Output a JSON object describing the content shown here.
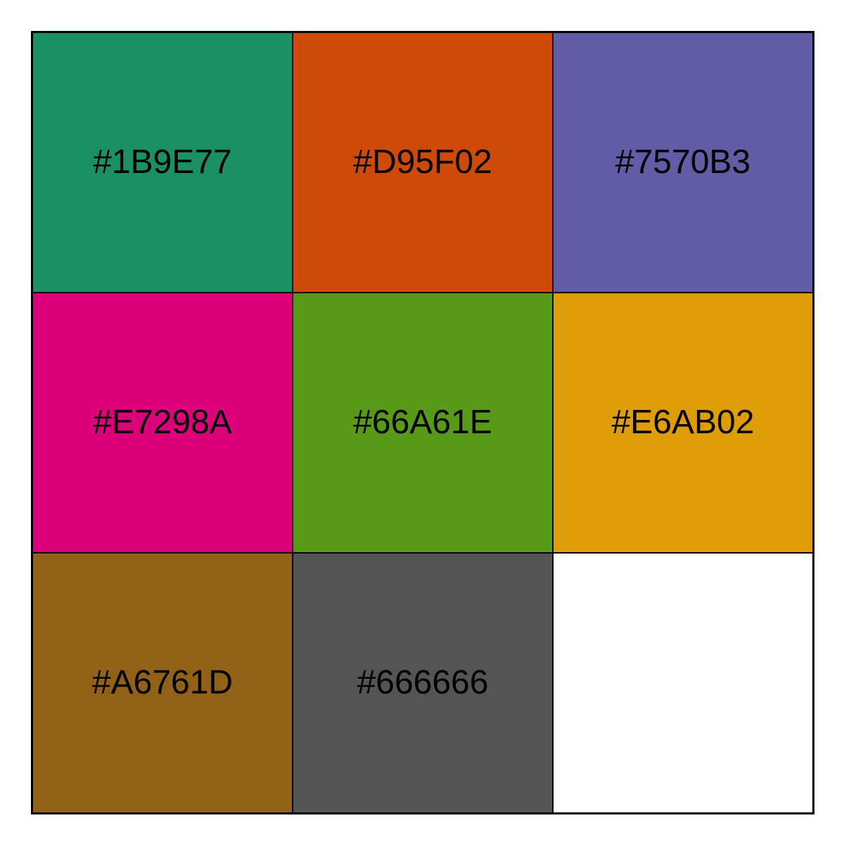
{
  "swatches": [
    {
      "label": "#1B9E77",
      "fill": "#1b8f65"
    },
    {
      "label": "#D95F02",
      "fill": "#cd4a09"
    },
    {
      "label": "#7570B3",
      "fill": "#625ba6"
    },
    {
      "label": "#E7298A",
      "fill": "#dd007b"
    },
    {
      "label": "#66A61E",
      "fill": "#589a18"
    },
    {
      "label": "#E6AB02",
      "fill": "#de9d07"
    },
    {
      "label": "#A6761D",
      "fill": "#926118"
    },
    {
      "label": "#666666",
      "fill": "#545454"
    },
    {
      "label": "",
      "fill": "#ffffff"
    }
  ]
}
